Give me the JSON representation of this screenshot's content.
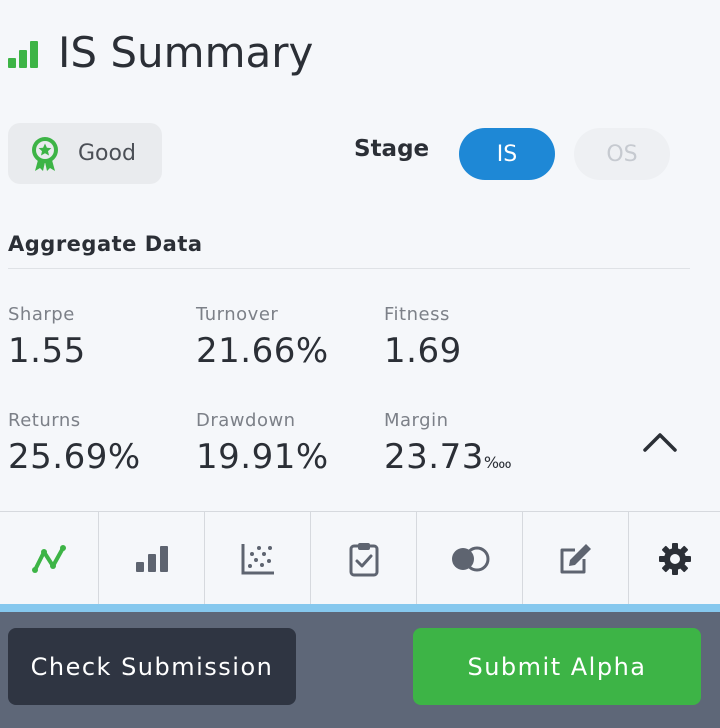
{
  "header": {
    "title": "IS Summary",
    "icon": "signal-bars-icon",
    "accent_color": "#3db446"
  },
  "grade": {
    "label": "Good",
    "icon": "award-icon"
  },
  "stage": {
    "label": "Stage",
    "options": [
      "IS",
      "OS"
    ],
    "selected": "IS"
  },
  "aggregate": {
    "title": "Aggregate Data",
    "metrics": [
      {
        "label": "Sharpe",
        "value": "1.55"
      },
      {
        "label": "Turnover",
        "value": "21.66%"
      },
      {
        "label": "Fitness",
        "value": "1.69"
      },
      {
        "label": "Returns",
        "value": "25.69%"
      },
      {
        "label": "Drawdown",
        "value": "19.91%"
      },
      {
        "label": "Margin",
        "value": "23.73",
        "unit": "‱"
      }
    ],
    "collapse_icon": "chevron-up-icon"
  },
  "tabs": [
    {
      "name": "line-chart",
      "icon": "line-chart-icon",
      "active": true
    },
    {
      "name": "bar-chart",
      "icon": "bar-chart-icon",
      "active": false
    },
    {
      "name": "scatter-plot",
      "icon": "scatter-plot-icon",
      "active": false
    },
    {
      "name": "checklist",
      "icon": "clipboard-check-icon",
      "active": false
    },
    {
      "name": "correlation",
      "icon": "overlap-circles-icon",
      "active": false
    },
    {
      "name": "edit",
      "icon": "edit-icon",
      "active": false
    },
    {
      "name": "settings",
      "icon": "gear-icon",
      "active": false
    }
  ],
  "footer": {
    "check_label": "Check Submission",
    "submit_label": "Submit Alpha"
  },
  "colors": {
    "primary_blue": "#1e88d6",
    "success_green": "#3db446",
    "footer_bg": "#5e6778",
    "dark_button": "#2f3542"
  }
}
